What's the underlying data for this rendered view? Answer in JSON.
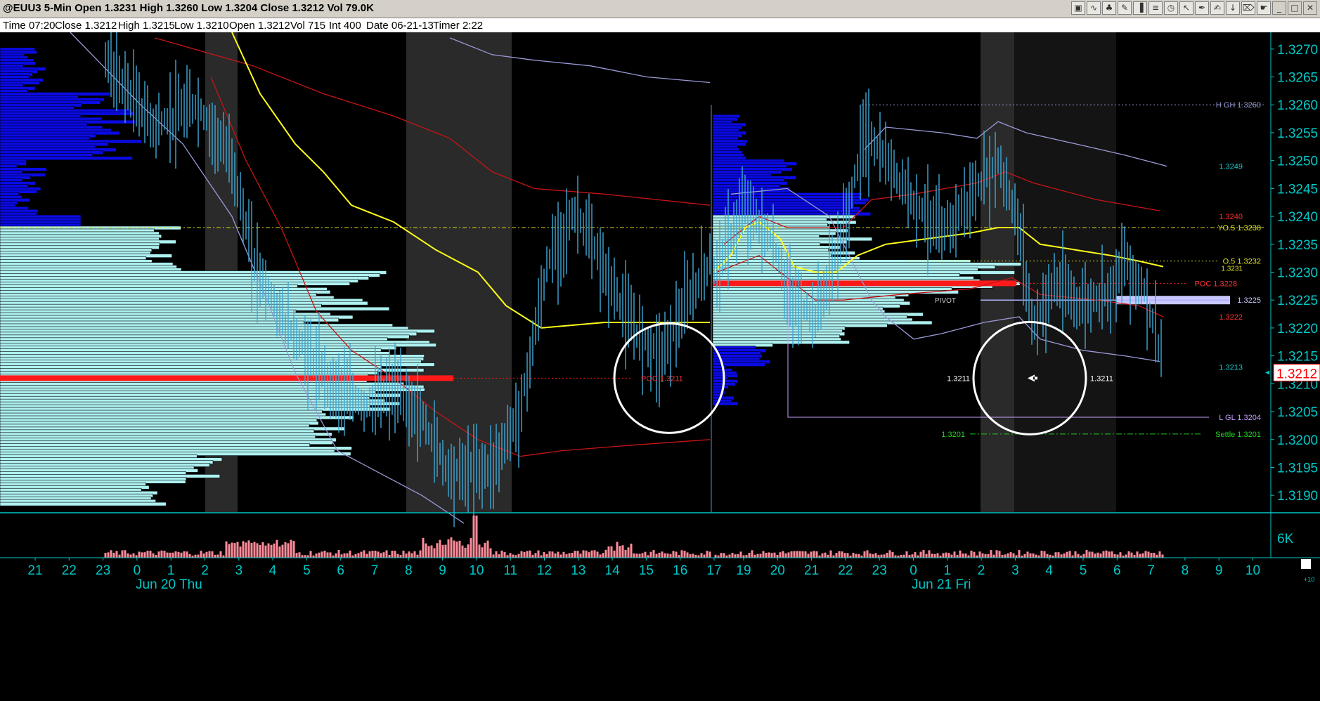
{
  "title": "@EUU3 5-Min Open 1.3231 High 1.3260 Low 1.3204 Close 1.3212 Vol 79.0K",
  "info": {
    "time": "Time 07:20",
    "close": "Close 1.3212",
    "high": "High 1.3215",
    "low": "Low 1.3210",
    "open": "Open 1.3212",
    "vol": "Vol 715",
    "int": "Int 400",
    "date": "Date 06-21-13",
    "timer": "Timer 2:22"
  },
  "toolbar_icons": [
    "chart-icon",
    "wave-icon",
    "tree-icon",
    "pencil-icon",
    "bars-icon",
    "fib-icon",
    "clock-icon",
    "cursor-icon",
    "pen-icon",
    "edit-icon",
    "arrow-down-icon",
    "trash-icon",
    "pointer-icon",
    "minimize-icon",
    "restore-icon",
    "close-icon"
  ],
  "colors": {
    "background": "#000000",
    "axis": "#00c8c8",
    "bar": "#3fa9d6",
    "profile_light": "#aef0f0",
    "profile_dark": "#0a0ae6",
    "poc": "#ff1a1a",
    "vwap": "#ffff1a",
    "band_red": "#c81414",
    "band_blue": "#9a9ad8",
    "volume": "#ff8c9a",
    "session_shade": "#2a2a2a"
  },
  "chart_data": {
    "type": "candlestick",
    "symbol": "@EUU3",
    "interval": "5-Min",
    "ylim": [
      1.3187,
      1.3273
    ],
    "y_ticks": [
      "1.3190",
      "1.3195",
      "1.3200",
      "1.3205",
      "1.3210",
      "1.3215",
      "1.3220",
      "1.3225",
      "1.3230",
      "1.3235",
      "1.3240",
      "1.3245",
      "1.3250",
      "1.3255",
      "1.3260",
      "1.3265",
      "1.3270"
    ],
    "last_price": "1.3212",
    "x_ticks_day1": [
      "21",
      "22",
      "23",
      "0",
      "1",
      "2",
      "3",
      "4",
      "5",
      "6",
      "7",
      "8",
      "9",
      "10",
      "11",
      "12",
      "13",
      "14",
      "15",
      "16",
      "17"
    ],
    "x_ticks_day2": [
      "19",
      "20",
      "21",
      "22",
      "23",
      "0",
      "1",
      "2",
      "3",
      "4",
      "5",
      "6",
      "7",
      "8",
      "9",
      "10"
    ],
    "date_labels": [
      "Jun 20 Thu",
      "Jun 21 Fri"
    ],
    "volume_axis_label": "6K",
    "annotations": {
      "high_gh": "H GH 1.3260",
      "val_1_3249": "1.3249",
      "val_1_3240": "1.3240",
      "yo5": "YO.5 1.3238",
      "o5": "O.5 1.3232",
      "val_1_3231": "1.3231",
      "poc_right": "POC 1.3228",
      "val_1_3225": "1.3225",
      "pivot": "PIVOT",
      "val_1_3222": "1.3222",
      "val_1_3213": "1.3213",
      "poc_left": "POC 1.3211",
      "circle_left": "1.3211",
      "circle_right": "1.3211",
      "low_gl": "L GL 1.3204",
      "settle_left": "1.3201",
      "settle": "Settle 1.3201",
      "corner": "+10"
    },
    "levels": {
      "high": 1.326,
      "yo5": 1.3238,
      "o5": 1.3232,
      "poc_right": 1.3228,
      "pivot": 1.3225,
      "poc_left": 1.3211,
      "low": 1.3204,
      "settle": 1.3201
    }
  }
}
